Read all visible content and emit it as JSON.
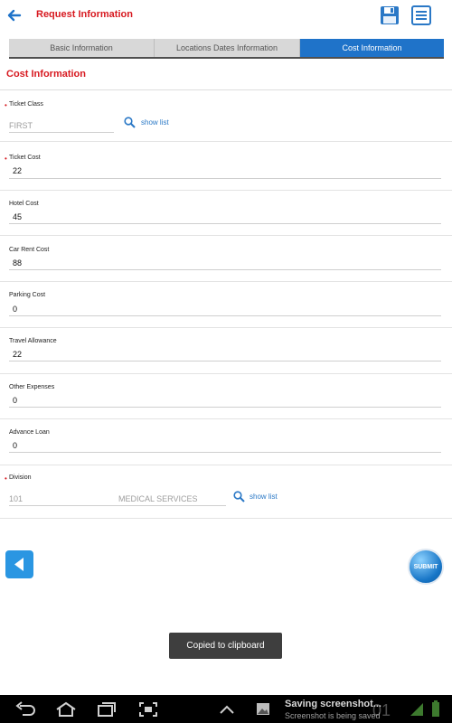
{
  "header": {
    "title": "Request Information"
  },
  "tabs": [
    {
      "label": "Basic Information",
      "active": false
    },
    {
      "label": "Locations Dates Information",
      "active": false
    },
    {
      "label": "Cost Information",
      "active": true
    }
  ],
  "section": {
    "title": "Cost Information"
  },
  "fields": {
    "ticket_class": {
      "label": "Ticket Class",
      "required": "•",
      "value": "FIRST",
      "show_list": "show list"
    },
    "ticket_cost": {
      "label": "Ticket Cost",
      "required": "•",
      "value": "22"
    },
    "hotel_cost": {
      "label": "Hotel Cost",
      "value": "45"
    },
    "car_rent_cost": {
      "label": "Car Rent Cost",
      "value": "88"
    },
    "parking_cost": {
      "label": "Parking Cost",
      "value": "0"
    },
    "travel_allowance": {
      "label": "Travel Allowance",
      "value": "22"
    },
    "other_expenses": {
      "label": "Other Expenses",
      "value": "0"
    },
    "advance_loan": {
      "label": "Advance Loan",
      "value": "0"
    },
    "division": {
      "label": "Division",
      "required": "•",
      "code": "101",
      "name": "MEDICAL SERVICES",
      "show_list": "show list"
    }
  },
  "actions": {
    "submit_label": "SUBMIT"
  },
  "toast": {
    "message": "Copied to clipboard"
  },
  "system_bar": {
    "notification_title": "Saving screenshot...",
    "notification_subtitle": "Screenshot is being saved",
    "clock": "01"
  },
  "colors": {
    "brand_red": "#d71920",
    "accent_blue": "#1f73c9"
  }
}
